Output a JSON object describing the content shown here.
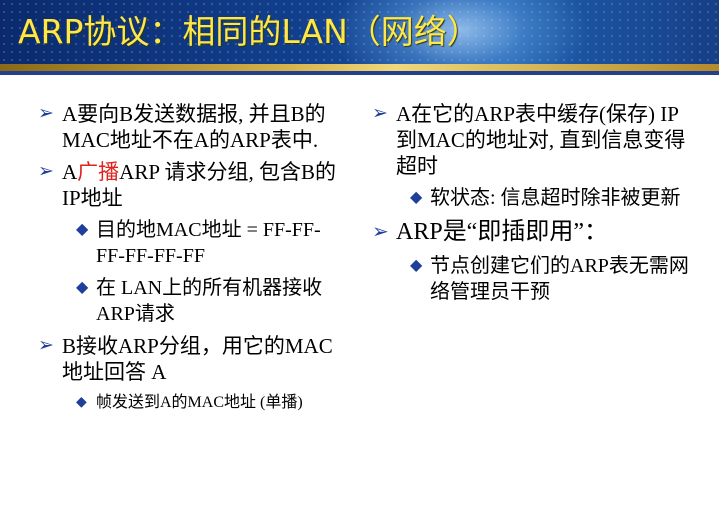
{
  "title": "ARP协议：相同的LAN（网络）",
  "colors": {
    "accent_red": "#e0221e",
    "bullet_blue": "#1f3f9a",
    "title_yellow": "#ffe64a"
  },
  "left": {
    "b1": {
      "text": "A要向B发送数据报, 并且B的MAC地址不在A的ARP表中."
    },
    "b2": {
      "prefix": "A",
      "highlight": "广播",
      "suffix": "ARP 请求分组, 包含B的IP地址",
      "subs": [
        "目的地MAC地址 = FF-FF-FF-FF-FF-FF",
        "在 LAN上的所有机器接收ARP请求"
      ]
    },
    "b3": {
      "text": "B接收ARP分组，用它的MAC地址回答 A",
      "sub": "帧发送到A的MAC地址 (单播)"
    }
  },
  "right": {
    "b1": {
      "text": "A在它的ARP表中缓存(保存) IP到MAC的地址对, 直到信息变得超时",
      "sub": "软状态: 信息超时除非被更新"
    },
    "b2": {
      "text": "ARP是“即插即用”：",
      "sub": "节点创建它们的ARP表无需网络管理员干预"
    }
  }
}
